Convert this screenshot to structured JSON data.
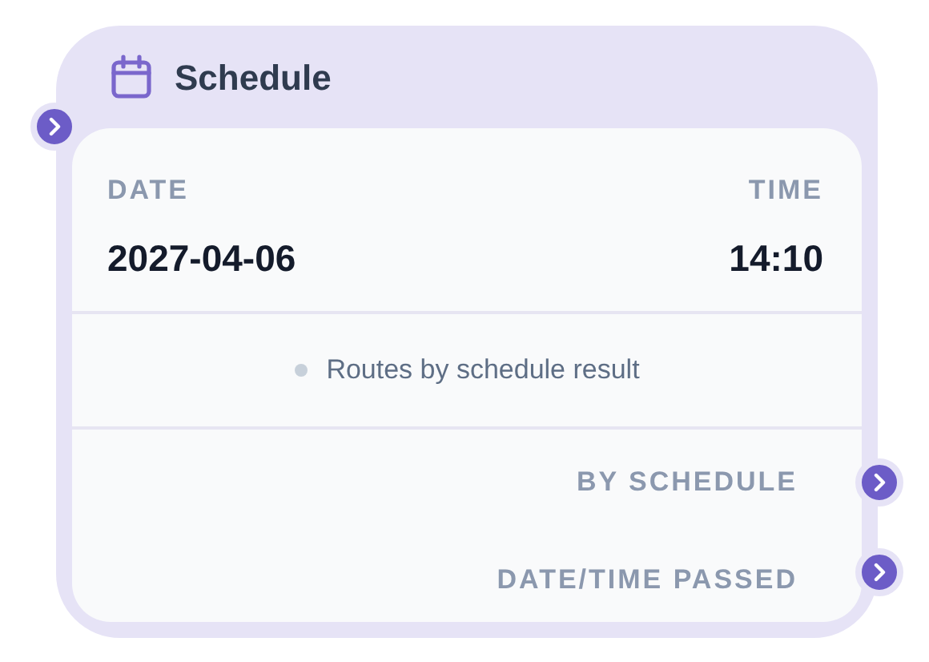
{
  "node": {
    "title": "Schedule"
  },
  "fields": [
    {
      "label": "DATE",
      "value": "2027-04-06"
    },
    {
      "label": "TIME",
      "value": "14:10"
    }
  ],
  "note": "Routes by schedule result",
  "outputs": [
    {
      "label": "BY SCHEDULE"
    },
    {
      "label": "DATE/TIME PASSED"
    }
  ]
}
